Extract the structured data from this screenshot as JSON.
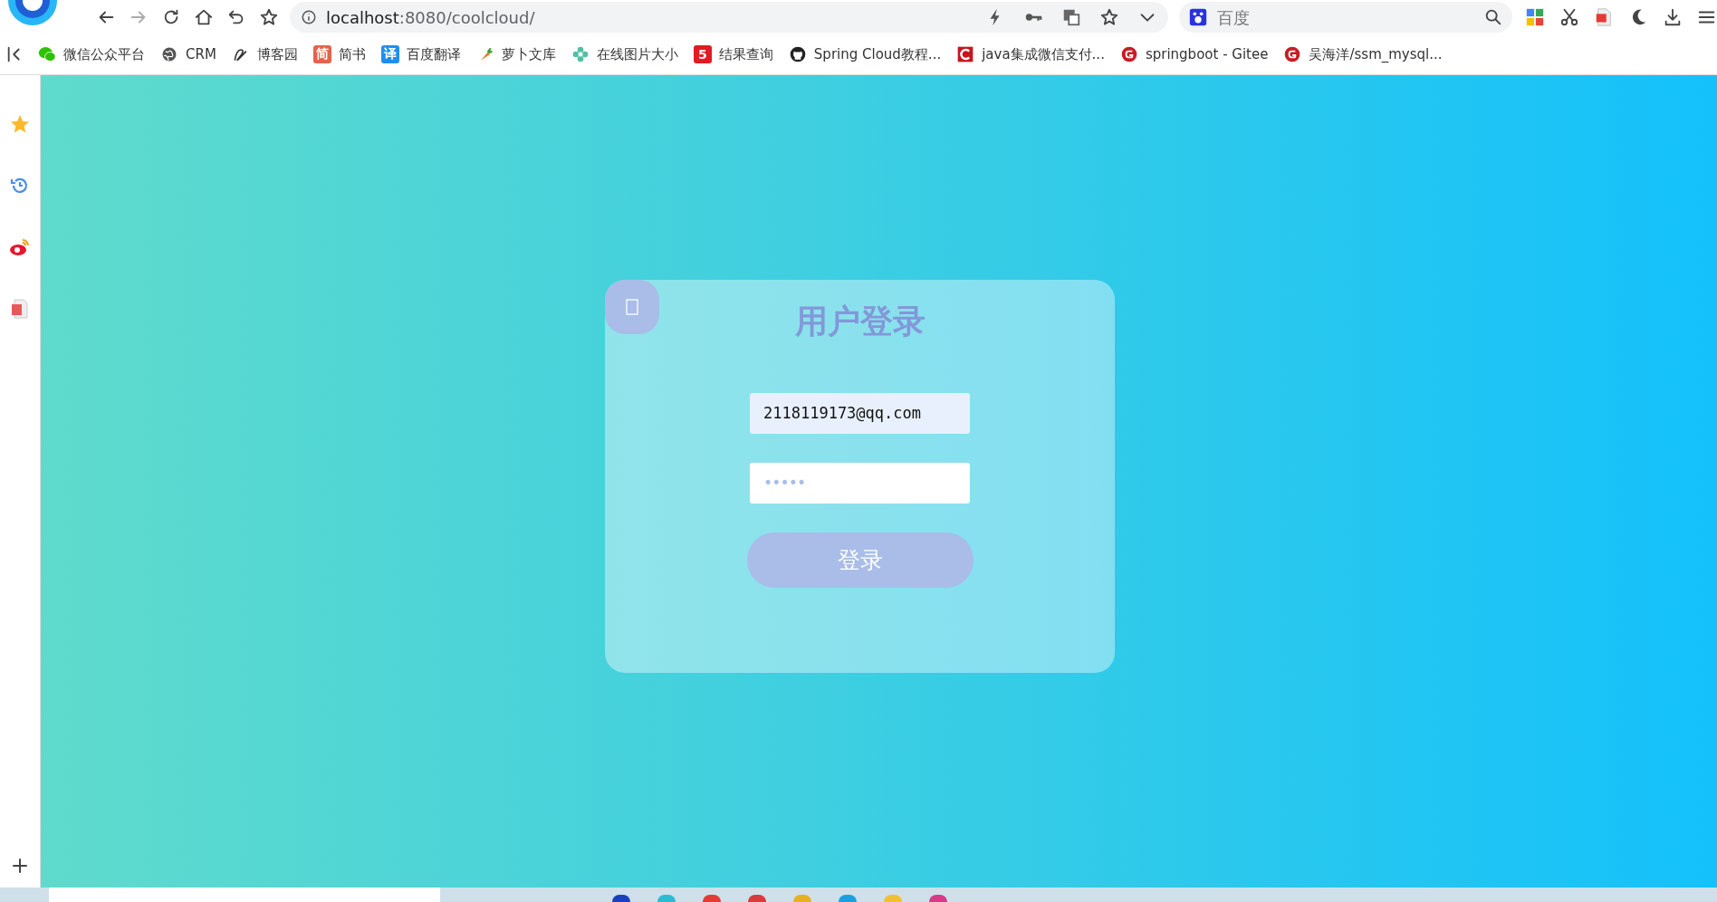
{
  "browser": {
    "address": {
      "host": "localhost",
      "path": ":8080/coolcloud/"
    },
    "search": {
      "placeholder": "百度"
    }
  },
  "bookmarks": [
    {
      "kind": "wechat",
      "label": "微信公众平台"
    },
    {
      "kind": "globe",
      "label": "CRM"
    },
    {
      "kind": "blog",
      "label": "博客园"
    },
    {
      "kind": "badge",
      "badge": "简",
      "color": "#e4634a",
      "label": "简书"
    },
    {
      "kind": "badge",
      "badge": "译",
      "color": "#1f8ef1",
      "label": "百度翻译"
    },
    {
      "kind": "carrot",
      "label": "萝卜文库"
    },
    {
      "kind": "flower",
      "label": "在线图片大小"
    },
    {
      "kind": "badge",
      "badge": "5",
      "color": "#e21a22",
      "label": "结果查询"
    },
    {
      "kind": "github",
      "label": "Spring Cloud教程..."
    },
    {
      "kind": "csdn",
      "label": "java集成微信支付..."
    },
    {
      "kind": "gitee",
      "label": "springboot - Gitee"
    },
    {
      "kind": "gitee",
      "label": "吴海洋/ssm_mysql..."
    }
  ],
  "login": {
    "title": "用户登录",
    "email": {
      "value": "2118119173@qq.com"
    },
    "password": {
      "value": "•••••"
    },
    "submit": "登录"
  }
}
